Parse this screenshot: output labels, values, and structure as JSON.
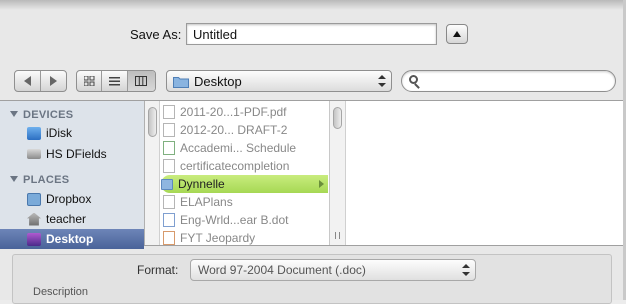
{
  "save_dialog": {
    "save_as_label": "Save As:",
    "filename_value": "Untitled"
  },
  "toolbar": {
    "location": "Desktop",
    "search_placeholder": ""
  },
  "sidebar": {
    "devices_header": "DEVICES",
    "devices": [
      {
        "label": "iDisk",
        "icon": "idisk-icon"
      },
      {
        "label": "HS DFields",
        "icon": "hard-drive-icon"
      }
    ],
    "places_header": "PLACES",
    "places": [
      {
        "label": "Dropbox",
        "icon": "dropbox-folder-icon"
      },
      {
        "label": "teacher",
        "icon": "home-icon"
      },
      {
        "label": "Desktop",
        "icon": "desktop-icon",
        "selected": true
      }
    ]
  },
  "files": [
    {
      "name": "2011-20...1-PDF.pdf",
      "type": "file"
    },
    {
      "name": "2012-20... DRAFT-2",
      "type": "file"
    },
    {
      "name": "Accademi... Schedule",
      "type": "file"
    },
    {
      "name": "certificatecompletion",
      "type": "file"
    },
    {
      "name": "Dynnelle",
      "type": "folder",
      "selected": true
    },
    {
      "name": "ELAPlans",
      "type": "file"
    },
    {
      "name": "Eng-Wrld...ear B.dot",
      "type": "file"
    },
    {
      "name": "FYT Jeopardy",
      "type": "file"
    }
  ],
  "options": {
    "format_label": "Format:",
    "format_value": "Word 97-2004 Document (.doc)",
    "description_label": "Description"
  },
  "colors": {
    "selection_green": "#b5e06a",
    "sidebar_bg": "#dde3ea",
    "sidebar_selected": "#5a73a8"
  }
}
